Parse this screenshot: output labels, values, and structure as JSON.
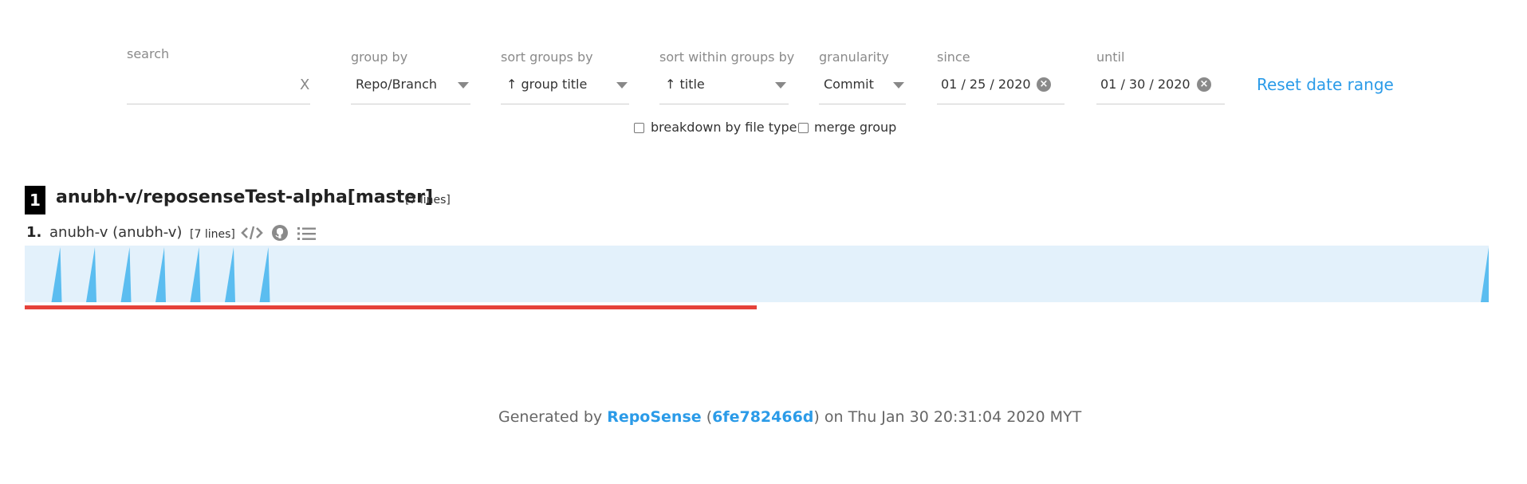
{
  "filters": {
    "search": {
      "label": "search",
      "value": "",
      "clear": "X"
    },
    "group_by": {
      "label": "group by",
      "value": "Repo/Branch"
    },
    "sort_groups_by": {
      "label": "sort groups by",
      "value": "↑ group title"
    },
    "sort_within_groups_by": {
      "label": "sort within groups by",
      "value": "↑ title"
    },
    "granularity": {
      "label": "granularity",
      "value": "Commit"
    },
    "since": {
      "label": "since",
      "value": "01 / 25 / 2020"
    },
    "until": {
      "label": "until",
      "value": "01 / 30 / 2020"
    },
    "reset": "Reset date range",
    "breakdown": {
      "label": "breakdown by file type",
      "checked": false
    },
    "merge": {
      "label": "merge group",
      "checked": false
    }
  },
  "group": {
    "rank": "1",
    "title": "anubh-v/reposenseTest-alpha[master]",
    "lines": "[7 lines]",
    "author": {
      "index": "1.",
      "name": "anubh-v (anubh-v)",
      "lines": "[7 lines]",
      "icons": [
        "code-icon",
        "github-icon",
        "list-icon"
      ],
      "ramp_commits": 7,
      "contribution_fraction": 0.5
    }
  },
  "footer": {
    "prefix": "Generated by ",
    "app": "RepoSense",
    "open_paren": " (",
    "commit": "6fe782466d",
    "rest": ") on Thu Jan 30 20:31:04 2020 MYT"
  },
  "colors": {
    "accent": "#2b9be8",
    "ramp_bg": "#e3f1fb",
    "ramp_tick": "#5bbdf0",
    "contribution_bar": "#e5423a"
  }
}
